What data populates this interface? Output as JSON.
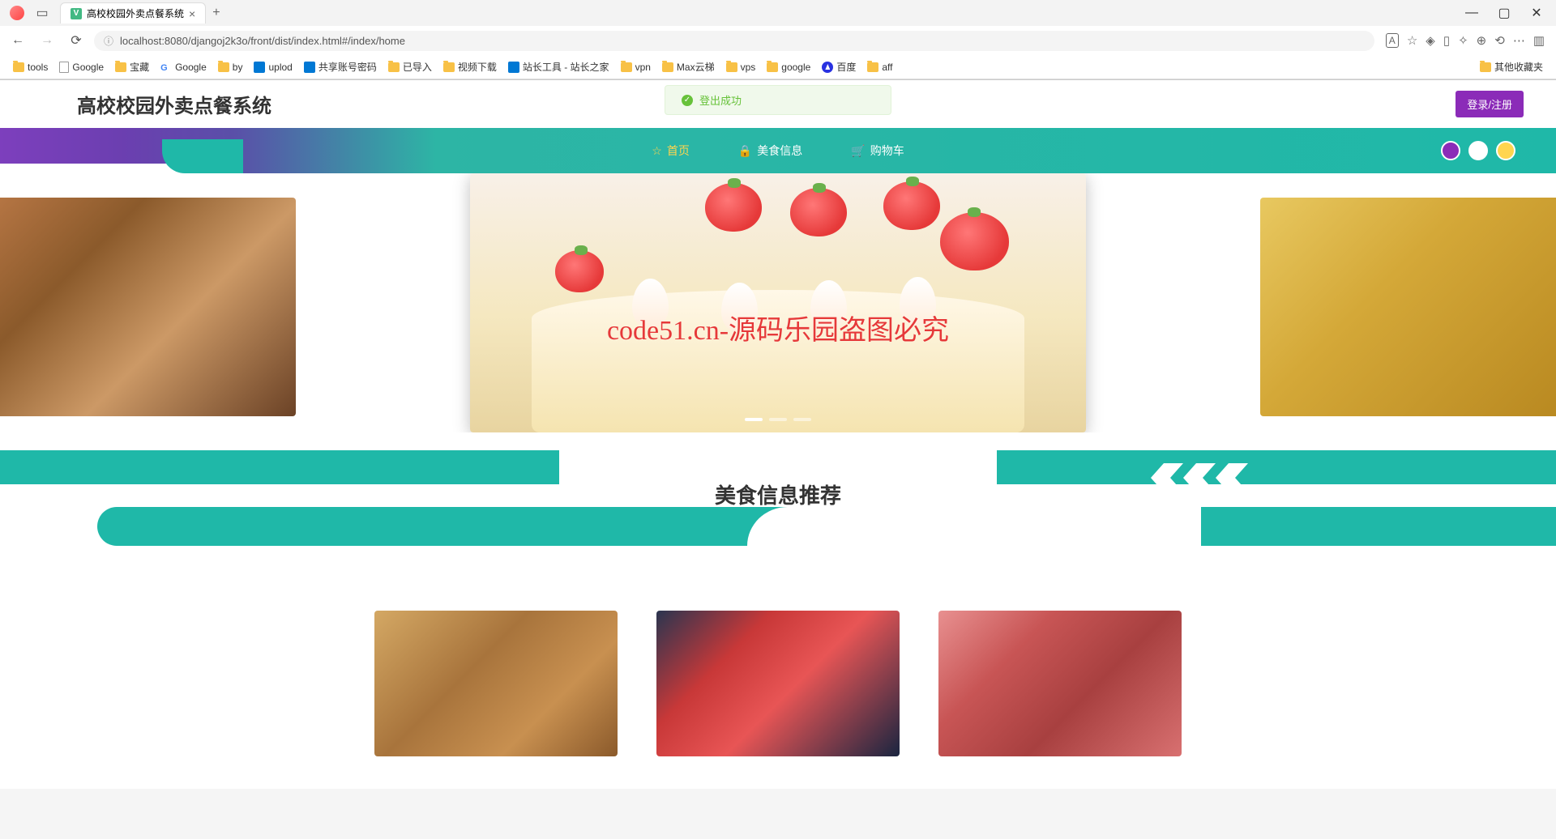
{
  "browser": {
    "tab_title": "高校校园外卖点餐系统",
    "url": "localhost:8080/djangoj2k3o/front/dist/index.html#/index/home",
    "new_tab": "+",
    "reading_list_label": "A",
    "other_bookmarks": "其他收藏夹"
  },
  "bookmarks": [
    {
      "label": "tools",
      "type": "folder"
    },
    {
      "label": "Google",
      "type": "page"
    },
    {
      "label": "宝藏",
      "type": "folder"
    },
    {
      "label": "Google",
      "type": "google"
    },
    {
      "label": "by",
      "type": "folder"
    },
    {
      "label": "uplod",
      "type": "blue"
    },
    {
      "label": "共享账号密码",
      "type": "blue"
    },
    {
      "label": "已导入",
      "type": "folder"
    },
    {
      "label": "视频下载",
      "type": "folder"
    },
    {
      "label": "站长工具 - 站长之家",
      "type": "blue"
    },
    {
      "label": "vpn",
      "type": "folder"
    },
    {
      "label": "Max云梯",
      "type": "folder"
    },
    {
      "label": "vps",
      "type": "folder"
    },
    {
      "label": "google",
      "type": "folder"
    },
    {
      "label": "百度",
      "type": "baidu"
    },
    {
      "label": "aff",
      "type": "folder"
    }
  ],
  "site": {
    "title": "高校校园外卖点餐系统",
    "login_register": "登录/注册"
  },
  "toast": {
    "message": "登出成功"
  },
  "nav": {
    "items": [
      {
        "label": "首页",
        "icon": "star",
        "active": true
      },
      {
        "label": "美食信息",
        "icon": "lock",
        "active": false
      },
      {
        "label": "购物车",
        "icon": "cart",
        "active": false
      }
    ]
  },
  "watermark": {
    "text": "code51.cn",
    "center_text": "code51.cn-源码乐园盗图必究"
  },
  "recommend": {
    "title": "美食信息推荐"
  },
  "theme_colors": {
    "purple": "#8b2bb8",
    "white": "#ffffff",
    "yellow": "#ffd54f"
  }
}
